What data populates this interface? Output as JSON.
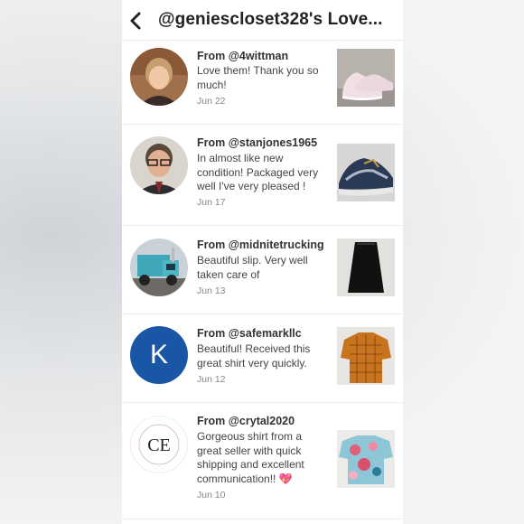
{
  "header": {
    "title": "@geniescloset328's Love..."
  },
  "reviews": [
    {
      "from_prefix": "From ",
      "handle": "@4wittman",
      "message": "Love them! Thank you so much!",
      "date": "Jun 22",
      "avatar_icon": "avatar-photo-woman",
      "thumb_icon": "sneakers-photo"
    },
    {
      "from_prefix": "From ",
      "handle": "@stanjones1965",
      "message": "In almost like new condition! Packaged very well I've very pleased !",
      "date": "Jun 17",
      "avatar_icon": "avatar-photo-man",
      "thumb_icon": "running-shoes-photo"
    },
    {
      "from_prefix": "From ",
      "handle": "@midnitetrucking",
      "message": "Beautiful slip. Very well taken care of",
      "date": "Jun 13",
      "avatar_icon": "avatar-photo-truck",
      "thumb_icon": "black-slip-photo"
    },
    {
      "from_prefix": "From ",
      "handle": "@safemarkllc",
      "message": "Beautiful! Received this great shirt very quickly.",
      "date": "Jun 12",
      "avatar_letter": "K",
      "avatar_color": "#1a56a6",
      "thumb_icon": "plaid-shirt-photo"
    },
    {
      "from_prefix": "From ",
      "handle": "@crytal2020",
      "message": "Gorgeous shirt from a great seller with quick shipping and excellent communication!! 💖",
      "date": "Jun 10",
      "avatar_monogram": "CE",
      "thumb_icon": "floral-shirt-photo"
    }
  ]
}
